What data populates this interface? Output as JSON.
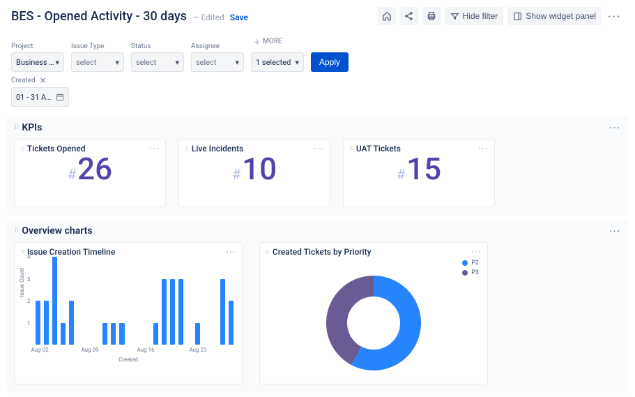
{
  "header": {
    "title": "BES - Opened Activity - 30 days",
    "edited": "— Edited",
    "save": "Save",
    "hide_filter": "Hide filter",
    "show_panel": "Show widget panel"
  },
  "filters": {
    "project": {
      "label": "Project",
      "value": "Business …"
    },
    "issue_type": {
      "label": "Issue Type",
      "value": "select"
    },
    "status": {
      "label": "Status",
      "value": "select"
    },
    "assignee": {
      "label": "Assignee",
      "value": "select"
    },
    "more": "MORE",
    "selected": {
      "value": "1 selected"
    },
    "apply": "Apply"
  },
  "created": {
    "label": "Created",
    "value": "01 - 31 A…"
  },
  "sections": {
    "kpis": {
      "title": "KPIs",
      "cards": [
        {
          "title": "Tickets Opened",
          "value": "26"
        },
        {
          "title": "Live Incidents",
          "value": "10"
        },
        {
          "title": "UAT Tickets",
          "value": "15"
        }
      ]
    },
    "overview": {
      "title": "Overview charts",
      "timeline_title": "Issue Creation Timeline",
      "priority_title": "Created Tickets by Priority",
      "legend": {
        "p2": "P2",
        "p3": "P3"
      }
    }
  },
  "chart_data": [
    {
      "type": "bar",
      "title": "Issue Creation Timeline",
      "xlabel": "Created",
      "ylabel": "Issue Count",
      "ylim": [
        0,
        4
      ],
      "yticks": [
        1,
        2,
        3,
        4
      ],
      "xticks": [
        "Aug 02",
        "Aug 09",
        "Aug 16",
        "Aug 23"
      ],
      "values": [
        2,
        2,
        4,
        1,
        2,
        0,
        0,
        0,
        1,
        1,
        1,
        0,
        0,
        0,
        1,
        3,
        3,
        3,
        0,
        1,
        0,
        0,
        3,
        2
      ]
    },
    {
      "type": "pie",
      "title": "Created Tickets by Priority",
      "series": [
        {
          "name": "P2",
          "value": 15,
          "color": "#2684FF"
        },
        {
          "name": "P3",
          "value": 11,
          "color": "#6B5B95"
        }
      ]
    }
  ]
}
